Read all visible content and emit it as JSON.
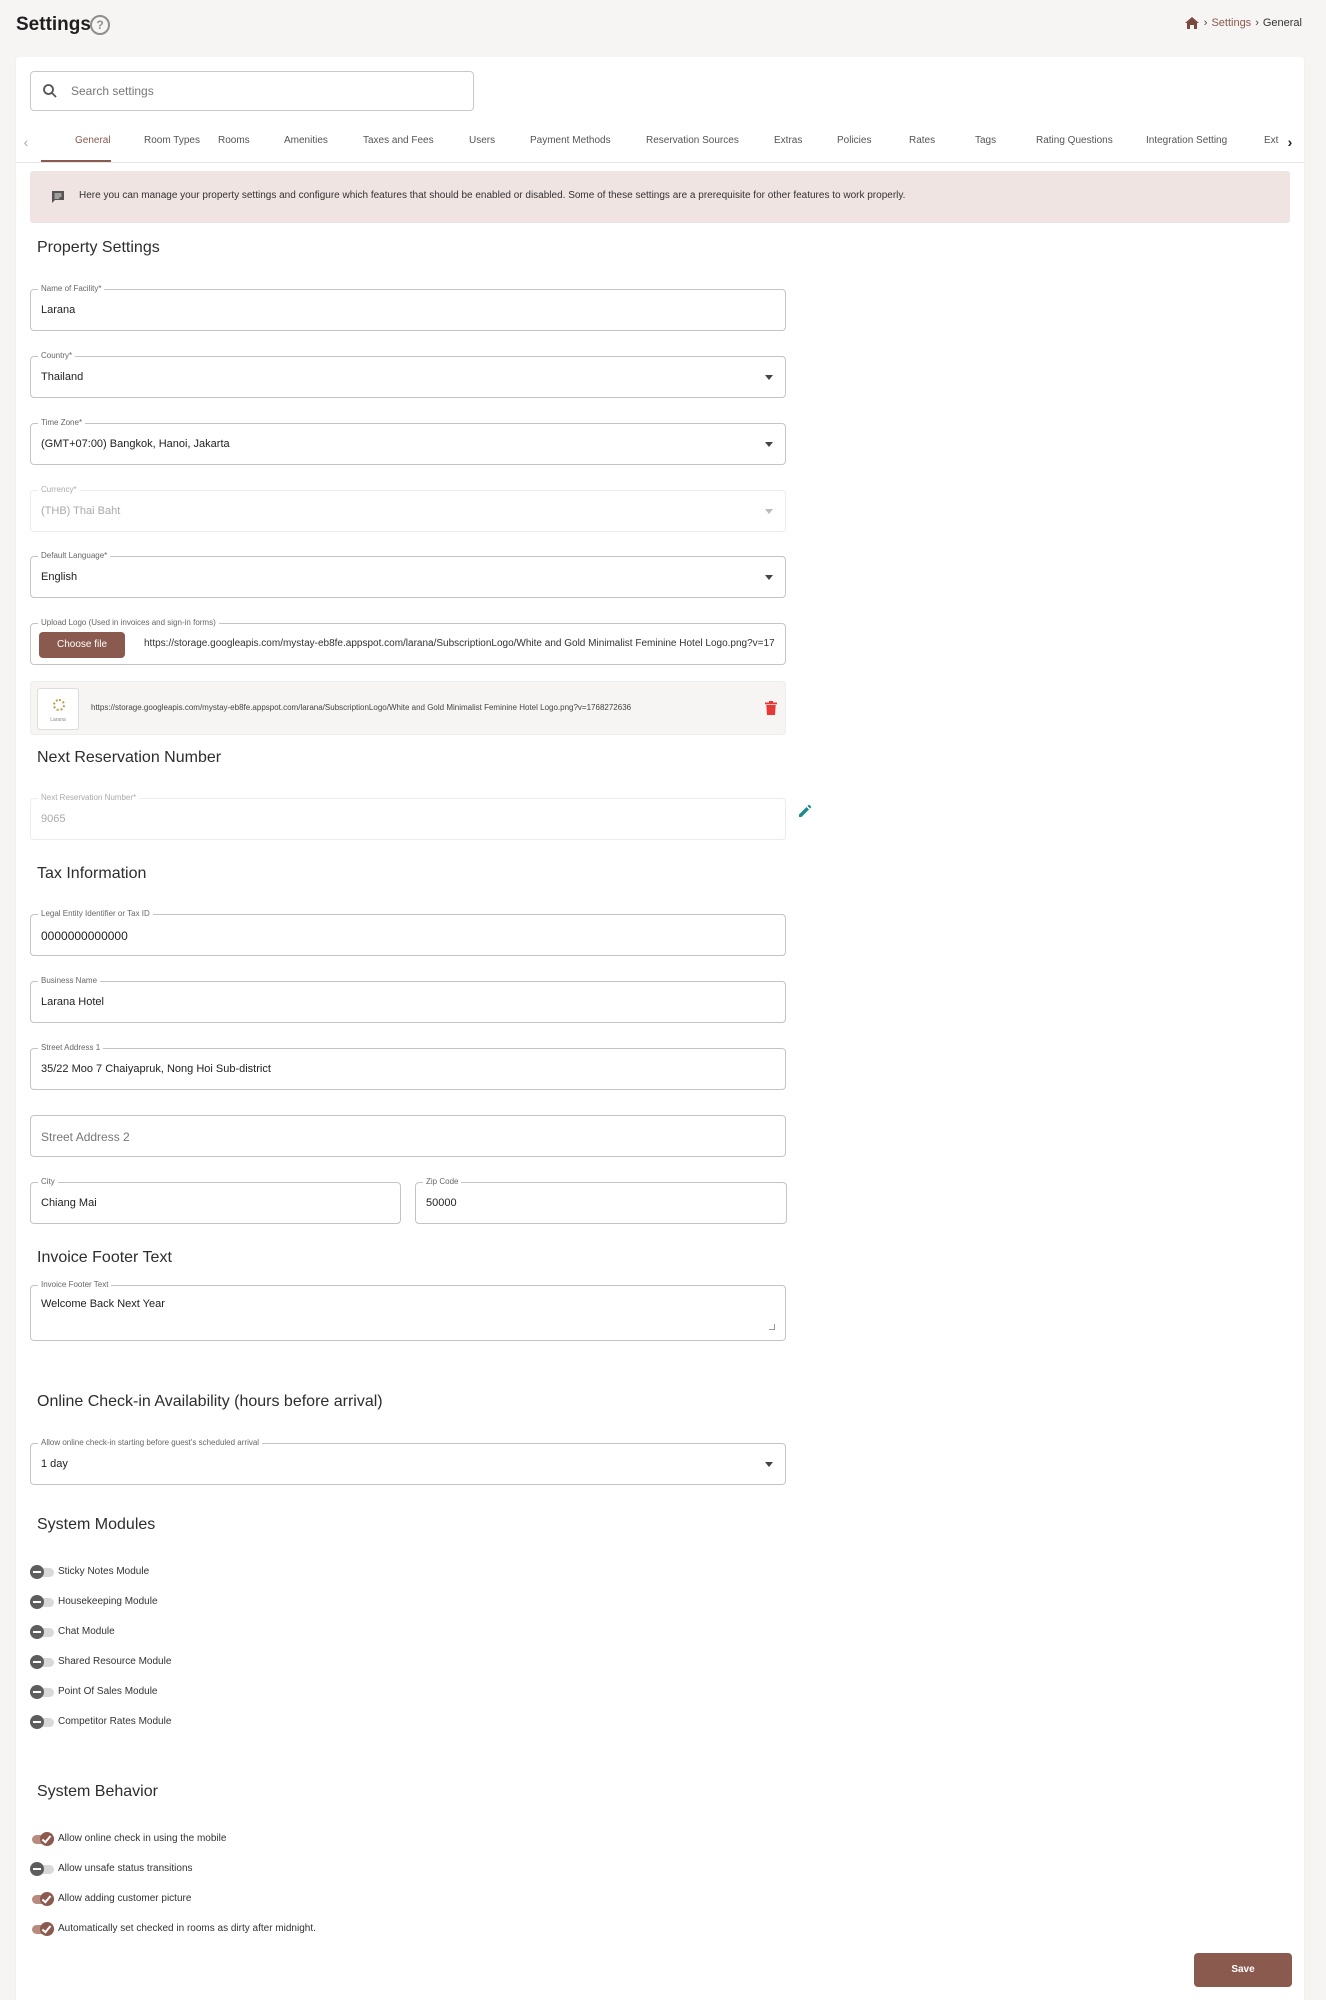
{
  "header": {
    "title": "Settings",
    "help_icon": "help-circle-icon",
    "breadcrumb": {
      "home_icon": "home-icon",
      "link": "Settings",
      "current": "General"
    }
  },
  "search": {
    "placeholder": "Search settings",
    "value": ""
  },
  "tabs": [
    {
      "label": "General",
      "active": true
    },
    {
      "label": "Room Types"
    },
    {
      "label": "Rooms"
    },
    {
      "label": "Amenities"
    },
    {
      "label": "Taxes and Fees"
    },
    {
      "label": "Users"
    },
    {
      "label": "Payment Methods"
    },
    {
      "label": "Reservation Sources"
    },
    {
      "label": "Extras"
    },
    {
      "label": "Policies"
    },
    {
      "label": "Rates"
    },
    {
      "label": "Tags"
    },
    {
      "label": "Rating Questions"
    },
    {
      "label": "Integration Setting"
    },
    {
      "label": "Ext"
    }
  ],
  "info_banner": "Here you can manage your property settings and configure which features that should be enabled or disabled. Some of these settings are a prerequisite for other features to work properly.",
  "property_settings": {
    "title": "Property Settings",
    "facility": {
      "label": "Name of Facility*",
      "value": "Larana"
    },
    "country": {
      "label": "Country*",
      "value": "Thailand"
    },
    "timezone": {
      "label": "Time Zone*",
      "value": "(GMT+07:00) Bangkok, Hanoi, Jakarta"
    },
    "currency": {
      "label": "Currency*",
      "value": "(THB) Thai Baht"
    },
    "language": {
      "label": "Default Language*",
      "value": "English"
    },
    "upload": {
      "label": "Upload Logo (Used in invoices and sign-in forms)",
      "button": "Choose file",
      "value": "https://storage.googleapis.com/mystay-eb8fe.appspot.com/larana/SubscriptionLogo/White and Gold Minimalist Feminine Hotel Logo.png?v=1768272636"
    },
    "logo_preview_url": "https://storage.googleapis.com/mystay-eb8fe.appspot.com/larana/SubscriptionLogo/White and Gold Minimalist Feminine Hotel Logo.png?v=1768272636",
    "logo_text": "Larana"
  },
  "next_reservation": {
    "title": "Next Reservation Number",
    "field": {
      "label": "Next Reservation Number*",
      "value": "9065"
    }
  },
  "tax_information": {
    "title": "Tax Information",
    "tax_id": {
      "label": "Legal Entity Identifier or Tax ID",
      "value": "0000000000000"
    },
    "business_name": {
      "label": "Business Name",
      "value": "Larana Hotel"
    },
    "street1": {
      "label": "Street Address 1",
      "value": "35/22 Moo 7 Chaiyapruk, Nong Hoi Sub-district"
    },
    "street2": {
      "placeholder": "Street Address 2"
    },
    "city": {
      "label": "City",
      "value": "Chiang Mai"
    },
    "zip": {
      "label": "Zip Code",
      "value": "50000"
    }
  },
  "invoice_footer": {
    "title": "Invoice Footer Text",
    "field": {
      "label": "Invoice Footer Text",
      "value": "Welcome Back Next Year"
    }
  },
  "online_checkin": {
    "title": "Online Check-in Availability (hours before arrival)",
    "field": {
      "label": "Allow online check-in starting before guest's scheduled arrival",
      "value": "1 day"
    }
  },
  "system_modules": {
    "title": "System Modules",
    "items": [
      {
        "label": "Sticky Notes Module",
        "enabled": false
      },
      {
        "label": "Housekeeping Module",
        "enabled": false
      },
      {
        "label": "Chat Module",
        "enabled": false
      },
      {
        "label": "Shared Resource Module",
        "enabled": false
      },
      {
        "label": "Point Of Sales Module",
        "enabled": false
      },
      {
        "label": "Competitor Rates Module",
        "enabled": false
      }
    ]
  },
  "system_behavior": {
    "title": "System Behavior",
    "items": [
      {
        "label": "Allow online check in using the mobile",
        "enabled": true
      },
      {
        "label": "Allow unsafe status transitions",
        "enabled": false
      },
      {
        "label": "Allow adding customer picture",
        "enabled": true
      },
      {
        "label": "Automatically set checked in rooms as dirty after midnight.",
        "enabled": true
      }
    ]
  },
  "save_label": "Save",
  "colors": {
    "accent": "#8a5a4e",
    "banner": "#efe4e2",
    "background": "#f6f5f4"
  }
}
